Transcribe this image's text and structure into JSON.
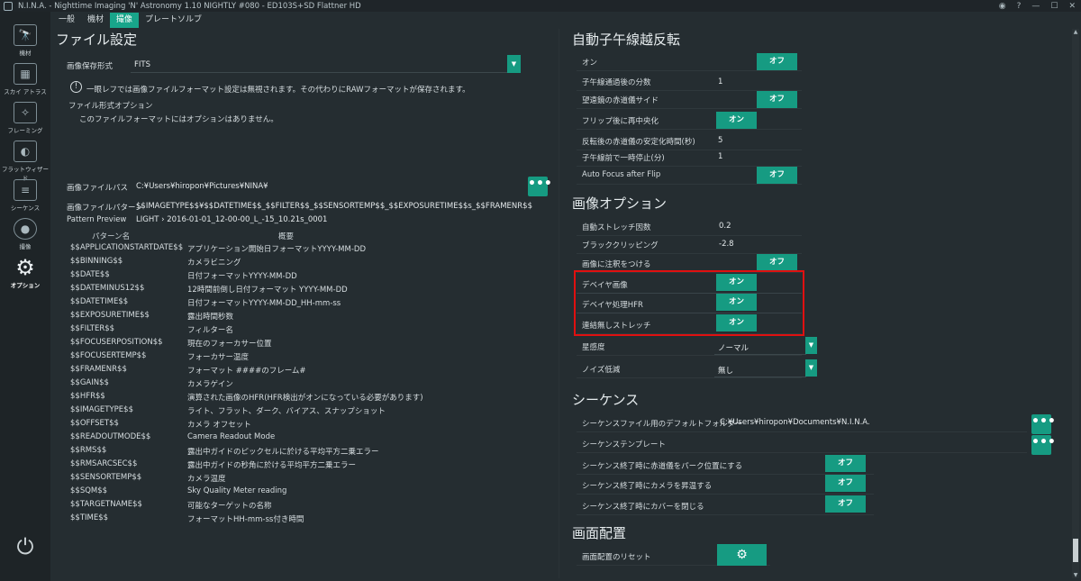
{
  "window": {
    "title": "N.I.N.A. - Nighttime Imaging 'N' Astronomy 1.10 NIGHTLY #080  -  ED103S+SD Flattner HD",
    "controls": [
      "◉",
      "?",
      "—",
      "☐",
      "✕"
    ]
  },
  "tabs": [
    {
      "label": "一般"
    },
    {
      "label": "機材"
    },
    {
      "label": "撮像"
    },
    {
      "label": "プレートソルブ"
    }
  ],
  "sidebar": {
    "items": [
      {
        "label": "機材",
        "icon": "telescope-icon",
        "glyph": "🔭"
      },
      {
        "label": "スカイ アトラス",
        "icon": "map-icon",
        "glyph": "▦"
      },
      {
        "label": "フレーミング",
        "icon": "framing-icon",
        "glyph": "✧"
      },
      {
        "label": "フラットウィザード",
        "icon": "flat-wizard-icon",
        "glyph": "◐"
      },
      {
        "label": "シーケンス",
        "icon": "sequence-icon",
        "glyph": "≡"
      },
      {
        "label": "撮像",
        "icon": "imaging-icon",
        "glyph": "●"
      },
      {
        "label": "オプション",
        "icon": "gears-icon",
        "glyph": "⚙"
      }
    ],
    "power_glyph": "⏻"
  },
  "left": {
    "file_settings_title": "ファイル設定",
    "image_format_label": "画像保存形式",
    "image_format_value": "FITS",
    "notice_icon": "!",
    "notice_text": "一眼レフでは画像ファイルフォーマット設定は無視されます。その代わりにRAWフォーマットが保存されます。",
    "file_options_label": "ファイル形式オプション",
    "file_options_text": "このファイルフォーマットにはオプションはありません。",
    "file_path_label": "画像ファイルパス",
    "file_path_value": "C:¥Users¥hiropon¥Pictures¥NINA¥",
    "file_pattern_label": "画像ファイルパターン",
    "file_pattern_value": "$$IMAGETYPE$$¥$$DATETIME$$_$$FILTER$$_$$SENSORTEMP$$_$$EXPOSURETIME$$s_$$FRAMENR$$",
    "pattern_preview_label": "Pattern Preview",
    "pattern_preview_value": "LIGHT › 2016-01-01_12-00-00_L_-15_10.21s_0001",
    "dots": "•••",
    "table_headers": {
      "pattern": "パターン名",
      "description": "概要"
    },
    "patterns": [
      {
        "key": "$$APPLICATIONSTARTDATE$$",
        "desc": "アプリケーション開始日フォーマットYYYY-MM-DD"
      },
      {
        "key": "$$BINNING$$",
        "desc": "カメラビニング"
      },
      {
        "key": "$$DATE$$",
        "desc": "日付フォーマットYYYY-MM-DD"
      },
      {
        "key": "$$DATEMINUS12$$",
        "desc": "12時間前倒し日付フォーマット YYYY-MM-DD"
      },
      {
        "key": "$$DATETIME$$",
        "desc": "日付フォーマットYYYY-MM-DD_HH-mm-ss"
      },
      {
        "key": "$$EXPOSURETIME$$",
        "desc": "露出時間秒数"
      },
      {
        "key": "$$FILTER$$",
        "desc": "フィルター名"
      },
      {
        "key": "$$FOCUSERPOSITION$$",
        "desc": "現在のフォーカサー位置"
      },
      {
        "key": "$$FOCUSERTEMP$$",
        "desc": "フォーカサー温度"
      },
      {
        "key": "$$FRAMENR$$",
        "desc": "フォーマット ####のフレーム#"
      },
      {
        "key": "$$GAIN$$",
        "desc": "カメラゲイン"
      },
      {
        "key": "$$HFR$$",
        "desc": "演算された画像のHFR(HFR検出がオンになっている必要があります)"
      },
      {
        "key": "$$IMAGETYPE$$",
        "desc": "ライト、フラット、ダーク、バイアス、スナップショット"
      },
      {
        "key": "$$OFFSET$$",
        "desc": "カメラ オフセット"
      },
      {
        "key": "$$READOUTMODE$$",
        "desc": "Camera Readout Mode"
      },
      {
        "key": "$$RMS$$",
        "desc": "露出中ガイドのピックセルに於ける平均平方二乗エラー"
      },
      {
        "key": "$$RMSARCSEC$$",
        "desc": "露出中ガイドの秒角に於ける平均平方二乗エラー"
      },
      {
        "key": "$$SENSORTEMP$$",
        "desc": "カメラ温度"
      },
      {
        "key": "$$SQM$$",
        "desc": "Sky Quality Meter reading"
      },
      {
        "key": "$$TARGETNAME$$",
        "desc": "可能なターゲットの名称"
      },
      {
        "key": "$$TIME$$",
        "desc": "フォーマットHH-mm-ss付き時間"
      }
    ]
  },
  "right": {
    "meridian_title": "自動子午線越反転",
    "meridian": {
      "on_label": "オン",
      "on_toggle": "オフ",
      "minutes_after_label": "子午線通過後の分数",
      "minutes_after_value": "1",
      "pier_side_label": "望遠鏡の赤道儀サイド",
      "pier_side_toggle": "オフ",
      "recenter_label": "フリップ後に再中央化",
      "recenter_toggle": "オン",
      "settle_label": "反転後の赤道儀の安定化時間(秒)",
      "settle_value": "5",
      "pause_label": "子午線前で一時停止(分)",
      "pause_value": "1",
      "af_label": "Auto Focus after Flip",
      "af_toggle": "オフ"
    },
    "image_options_title": "画像オプション",
    "image_options": {
      "stretch_label": "自動ストレッチ因数",
      "stretch_value": "0.2",
      "clip_label": "ブラッククリッピング",
      "clip_value": "-2.8",
      "annotate_label": "画像に注釈をつける",
      "annotate_toggle": "オフ",
      "debayer_label": "デベイヤ画像",
      "debayer_toggle": "オン",
      "debayer_hfr_label": "デベイヤ処理HFR",
      "debayer_hfr_toggle": "オン",
      "unlinked_label": "連結無しストレッチ",
      "unlinked_toggle": "オン",
      "star_sens_label": "星感度",
      "star_sens_value": "ノーマル",
      "noise_label": "ノイズ低減",
      "noise_value": "無し"
    },
    "sequence_title": "シーケンス",
    "sequence": {
      "folder_label": "シーケンスファイル用のデフォルトフォルダー",
      "folder_value": "C:¥Users¥hiropon¥Documents¥N.I.N.A.",
      "template_label": "シーケンステンプレート",
      "park_label": "シーケンス終了時に赤道儀をパーク位置にする",
      "park_toggle": "オフ",
      "warm_label": "シーケンス終了時にカメラを昇温する",
      "warm_toggle": "オフ",
      "cover_label": "シーケンス終了時にカバーを閉じる",
      "cover_toggle": "オフ"
    },
    "layout_title": "画面配置",
    "layout_reset_label": "画面配置のリセット",
    "gear_glyph": "⚙"
  },
  "colors": {
    "accent": "#169b82",
    "tab_active": "#18a58a",
    "highlight": "#e01010",
    "background": "#252d31"
  }
}
